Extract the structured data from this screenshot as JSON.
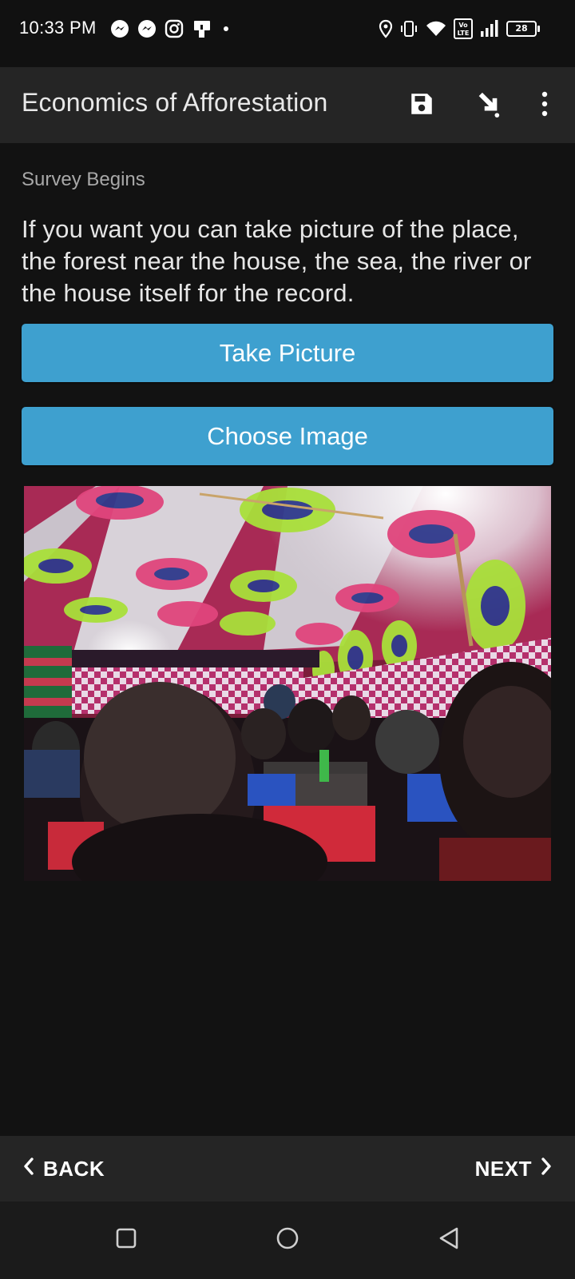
{
  "status_bar": {
    "time": "10:33 PM",
    "notification_icons": [
      "messenger-icon",
      "messenger-icon",
      "instagram-icon",
      "app-notification-icon",
      "dot-icon"
    ],
    "system_icons": [
      "location-icon",
      "vibrate-icon",
      "wifi-icon",
      "volte-icon",
      "signal-icon",
      "battery-icon"
    ],
    "volte_label": "Vo LTE",
    "battery_level": "28"
  },
  "app_bar": {
    "title": "Economics of Afforestation",
    "actions": [
      "save-icon",
      "jump-to-icon",
      "more-vert-icon"
    ]
  },
  "form": {
    "group_label": "Survey Begins",
    "question": "If you want you can take picture of the place, the forest near the house, the sea, the river or the house itself for the record.",
    "take_picture_label": "Take Picture",
    "choose_image_label": "Choose Image",
    "button_color": "#3ea0cf"
  },
  "bottom_nav": {
    "back_label": "BACK",
    "next_label": "NEXT"
  },
  "system_nav": [
    "recents-square-icon",
    "home-circle-icon",
    "back-triangle-icon"
  ]
}
